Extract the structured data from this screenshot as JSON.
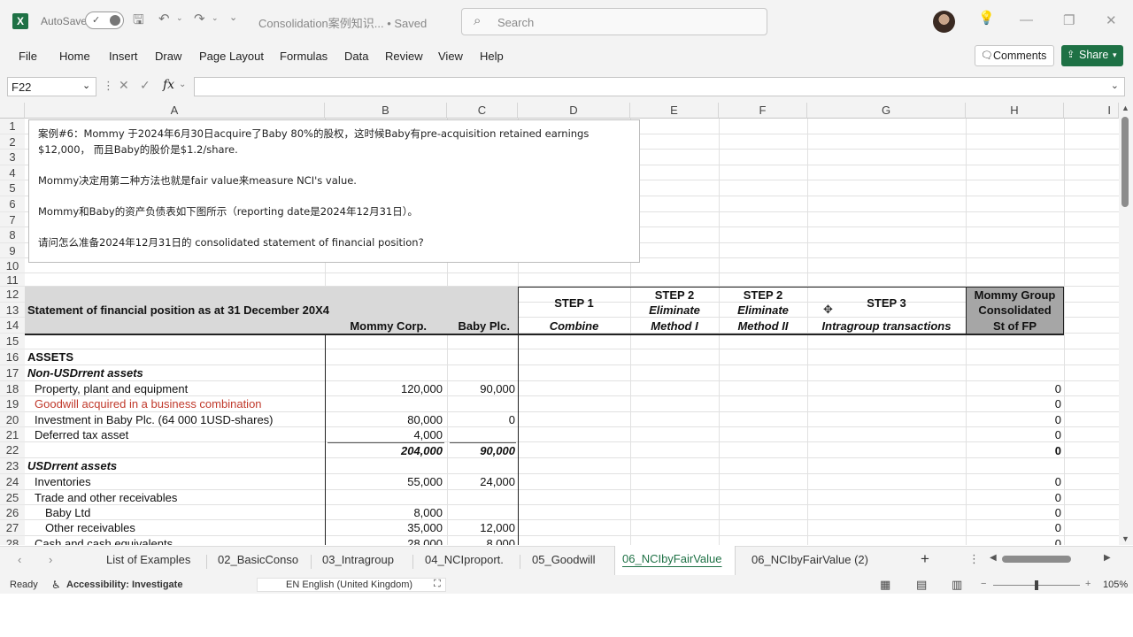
{
  "titlebar": {
    "autosave_label": "AutoSave",
    "doc_title": "Consolidation案例知识...  • Saved",
    "search_placeholder": "Search"
  },
  "menu": {
    "items": [
      "File",
      "Home",
      "Insert",
      "Draw",
      "Page Layout",
      "Formulas",
      "Data",
      "Review",
      "View",
      "Help"
    ],
    "comments_label": "Comments",
    "share_label": "Share"
  },
  "formula_bar": {
    "name_box": "F22",
    "fx_symbol": "fx",
    "content": ""
  },
  "columns": [
    "A",
    "B",
    "C",
    "D",
    "E",
    "F",
    "G",
    "H",
    "I"
  ],
  "rows": [
    "1",
    "2",
    "3",
    "4",
    "5",
    "6",
    "7",
    "8",
    "9",
    "10",
    "11",
    "12",
    "13",
    "14",
    "15",
    "16",
    "17",
    "18",
    "19",
    "20",
    "21",
    "22",
    "23",
    "24",
    "25",
    "26",
    "27",
    "28"
  ],
  "textbox": {
    "line1": "案例#6：Mommy 于2024年6月30日acquire了Baby 80%的股权，这时候Baby有pre-acquisition retained earnings",
    "line2": "$12,000，  而且Baby的股价是$1.2/share.",
    "line3": "Mommy决定用第二种方法也就是fair value来measure NCI's value.",
    "line4": "Mommy和Baby的资产负债表如下图所示（reporting date是2024年12月31日）。",
    "line5": "请问怎么准备2024年12月31日的 consolidated statement of financial position?"
  },
  "sheet": {
    "header_title": "Statement of financial position as at 31 December 20X4",
    "col_b_header": "Mommy Corp.",
    "col_c_header": "Baby Plc.",
    "step1_title": "STEP 1",
    "step1_sub": "Combine",
    "step2a_title": "STEP 2",
    "step2a_sub1": "Eliminate",
    "step2a_sub2": "Method I",
    "step2b_title": "STEP 2",
    "step2b_sub1": "Eliminate",
    "step2b_sub2": "Method II",
    "step3_title": "STEP 3",
    "step3_sub": "Intragroup transactions",
    "h_line1": "Mommy Group",
    "h_line2": "Consolidated",
    "h_line3": "St of FP",
    "assets": "ASSETS",
    "noncurrent": "Non-USDrrent assets",
    "r18_label": "Property, plant and equipment",
    "r18_b": "120,000",
    "r18_c": "90,000",
    "r18_h": "0",
    "r19_label": "Goodwill acquired in a business combination",
    "r19_h": "0",
    "r20_label": "Investment in Baby Plc. (64 000 1USD-shares)",
    "r20_b": "80,000",
    "r20_c": "0",
    "r20_h": "0",
    "r21_label": "Deferred tax asset",
    "r21_b": "4,000",
    "r21_h": "0",
    "r22_b": "204,000",
    "r22_c": "90,000",
    "r22_h": "0",
    "current": "USDrrent assets",
    "r24_label": "Inventories",
    "r24_b": "55,000",
    "r24_c": "24,000",
    "r24_h": "0",
    "r25_label": "Trade and other receivables",
    "r25_h": "0",
    "r26_label": "Baby Ltd",
    "r26_b": "8,000",
    "r26_h": "0",
    "r27_label": "Other receivables",
    "r27_b": "35,000",
    "r27_c": "12,000",
    "r27_h": "0",
    "r28_label": "Cash and cash equivalents",
    "r28_b": "28,000",
    "r28_c": "8,000",
    "r28_h": "0"
  },
  "tabs": [
    "List of Examples",
    "02_BasicConso",
    "03_Intragroup",
    "04_NCIproport.",
    "05_Goodwill",
    "06_NCIbyFairValue",
    "06_NCIbyFairValue (2)"
  ],
  "active_tab": "06_NCIbyFairValue",
  "status": {
    "ready": "Ready",
    "accessibility": "Accessibility: Investigate",
    "language": "EN English (United Kingdom)",
    "zoom": "105%"
  }
}
